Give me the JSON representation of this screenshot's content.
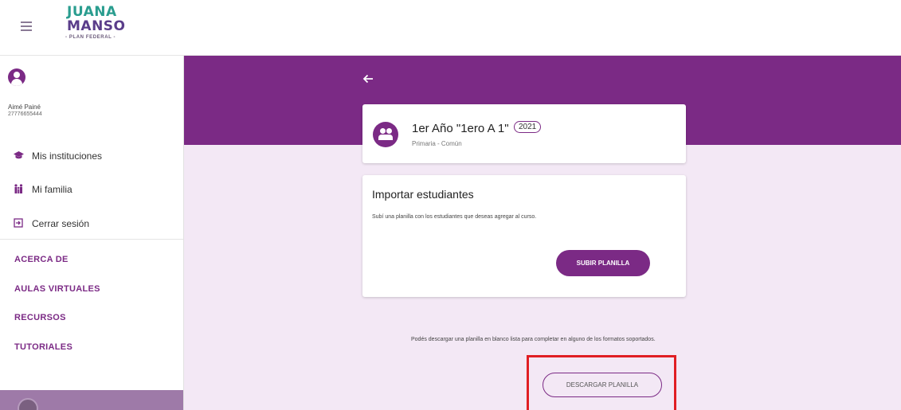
{
  "header": {
    "logo": {
      "line1": "JUANA",
      "line2": "MANSO",
      "subtitle": "- PLAN FEDERAL -"
    }
  },
  "user": {
    "name": "Aimé Painé",
    "id": "27776655444"
  },
  "sidebar": {
    "items": [
      {
        "label": "Mis instituciones",
        "icon": "graduation-cap-icon"
      },
      {
        "label": "Mi familia",
        "icon": "family-icon"
      },
      {
        "label": "Cerrar sesión",
        "icon": "logout-icon"
      }
    ],
    "links": [
      "ACERCA DE",
      "AULAS VIRTUALES",
      "RECURSOS",
      "TUTORIALES"
    ]
  },
  "course": {
    "title": "1er Año \"1ero A 1\"",
    "year": "2021",
    "subtitle": "Primaria - Común"
  },
  "import": {
    "title": "Importar estudiantes",
    "description": "Subí una planilla con los estudiantes que deseas agregar al curso.",
    "upload_label": "SUBIR PLANILLA"
  },
  "download": {
    "note": "Podés descargar una planilla en blanco lista para completar en alguno de los formatos soportados.",
    "button_label": "DESCARGAR PLANILLA"
  },
  "colors": {
    "primary": "#7b2a85",
    "background": "#f3e8f5",
    "highlight": "#e01e24"
  }
}
